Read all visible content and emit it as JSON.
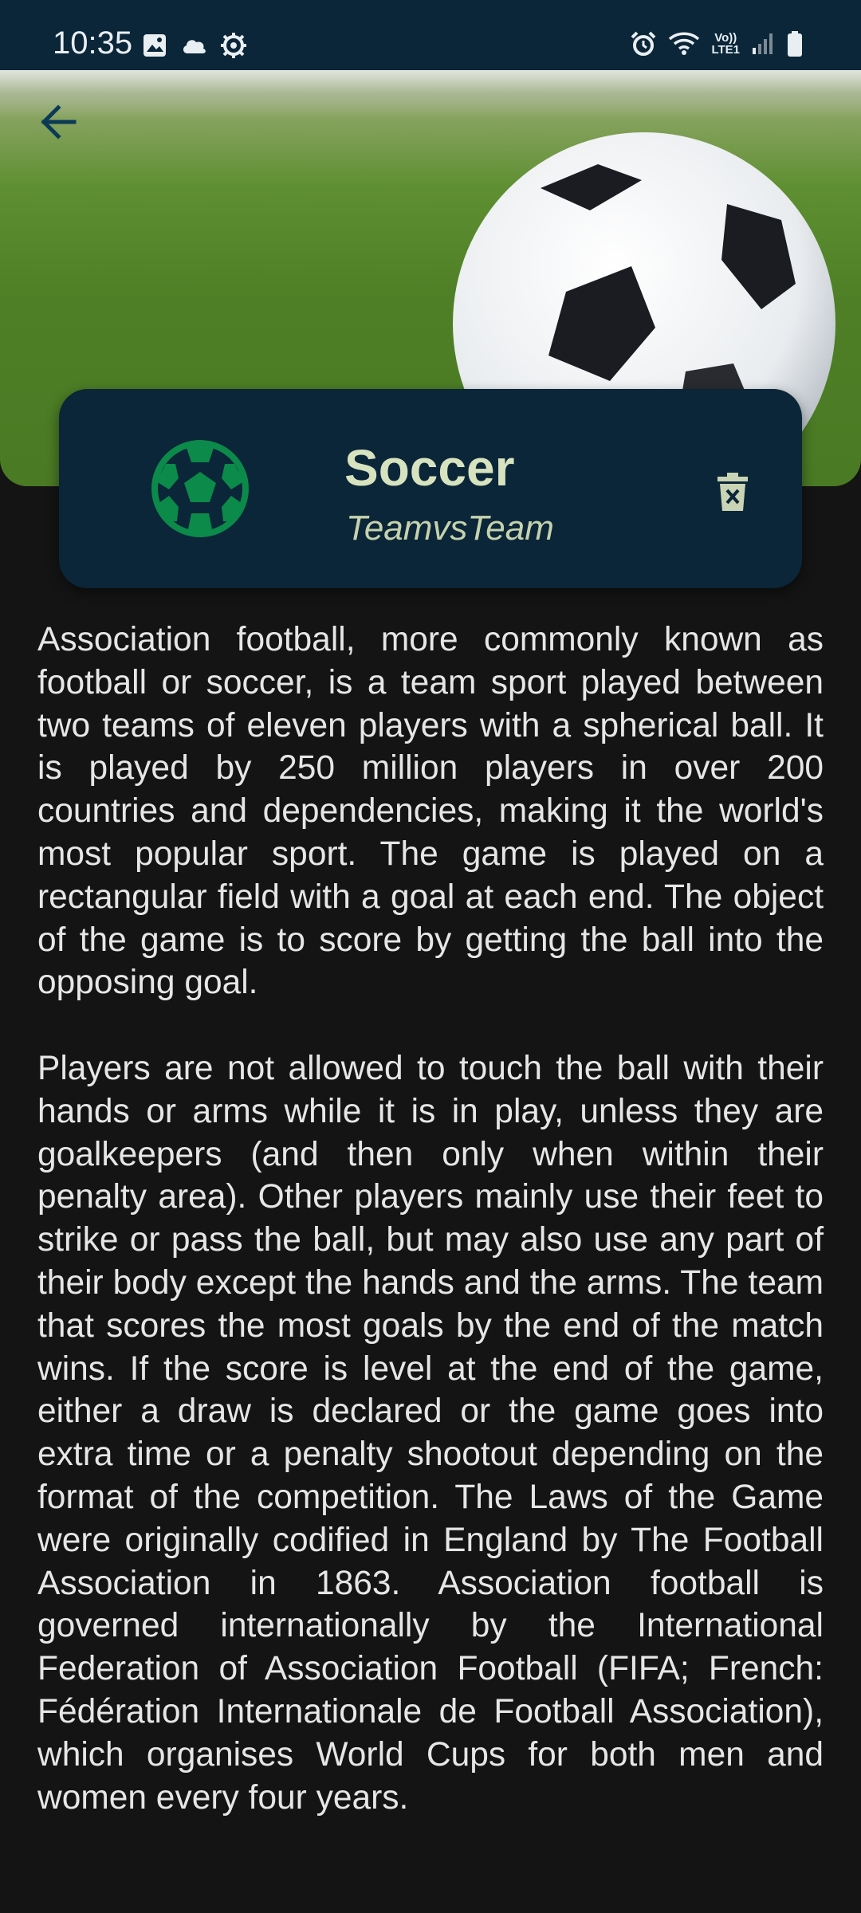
{
  "status_bar": {
    "time": "10:35",
    "left_icons": [
      "gallery-icon",
      "cloud-icon",
      "settings-icon"
    ],
    "right_icons": [
      "alarm-icon",
      "wifi-icon",
      "volte-icon",
      "signal-icon",
      "battery-icon"
    ],
    "volte_line1": "Vo))",
    "volte_line2": "LTE1"
  },
  "header": {
    "back_icon": "arrow-left-icon"
  },
  "sport": {
    "title": "Soccer",
    "subtitle": "TeamvsTeam",
    "icon": "soccer-ball-icon",
    "delete_icon": "trash-delete-icon"
  },
  "colors": {
    "background": "#141414",
    "card": "#0b2638",
    "accent_green": "#0b8a4a",
    "title_text": "#d7e2bf"
  },
  "description": "Association football, more commonly known as football or soccer, is a team sport played between two teams of eleven players with a spherical ball. It is played by 250 million players in over 200 countries and dependencies, making it the world's most popular sport. The game is played on a rectangular field with a goal at each end. The object of the game is to score by getting the ball into the opposing goal.\n\nPlayers are not allowed to touch the ball with their hands or arms while it is in play, unless they are goalkeepers (and then only when within their penalty area). Other players mainly use their feet to strike or pass the ball, but may also use any part of their body except the hands and the arms. The team that scores the most goals by the end of the match wins. If the score is level at the end of the game, either a draw is declared or the game goes into extra time or a penalty shootout depending on the format of the competition. The Laws of the Game were originally codified in England by The Football Association in 1863. Association football is governed internationally by the International Federation of Association Football (FIFA; French: Fédération Internationale de Football Association), which organises World Cups for both men and women every four years."
}
